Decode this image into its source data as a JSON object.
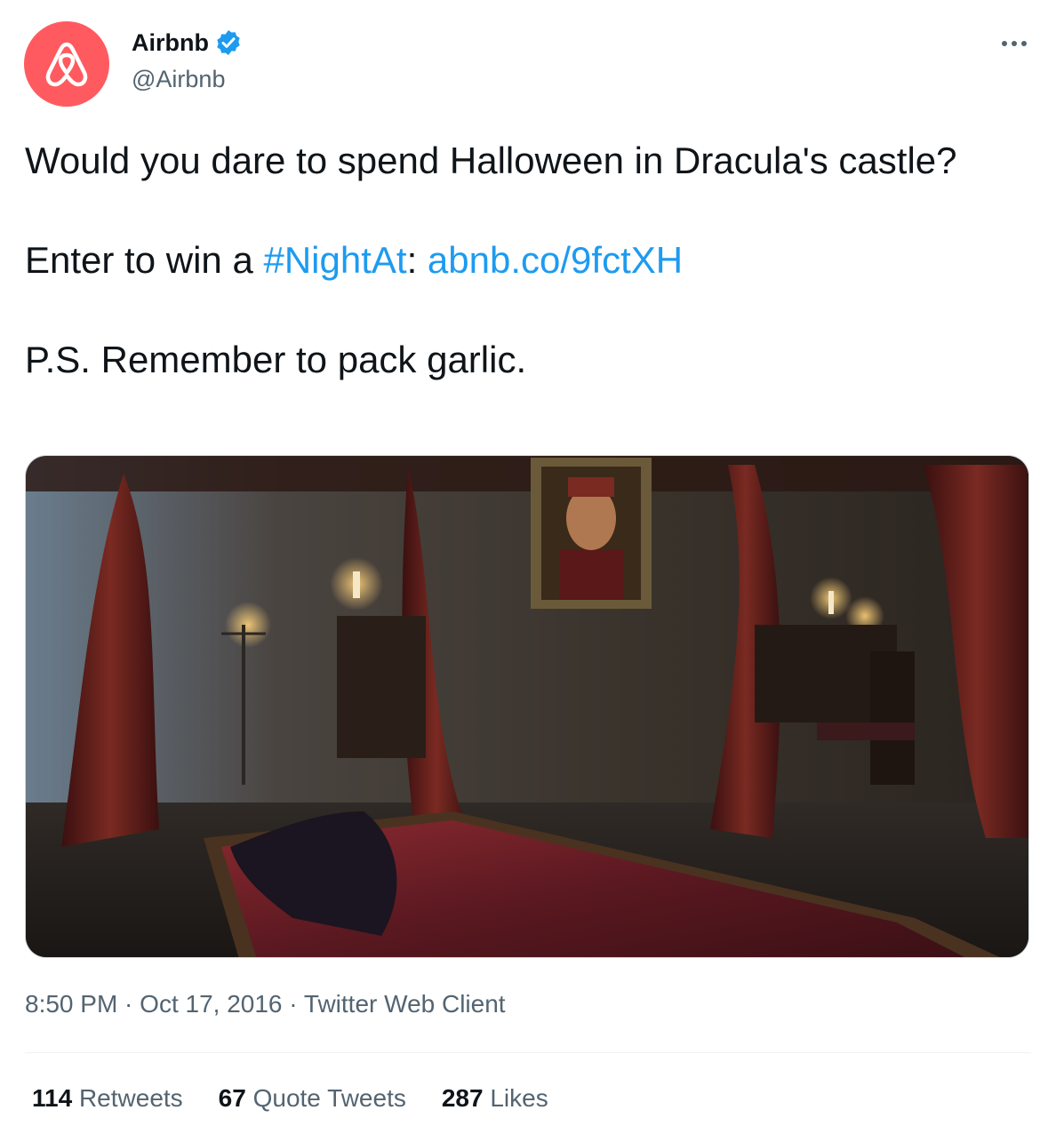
{
  "author": {
    "display_name": "Airbnb",
    "handle": "@Airbnb",
    "verified": true,
    "avatar_icon": "airbnb-logo-icon",
    "avatar_color": "#ff5a5f",
    "verified_color": "#1d9bf0"
  },
  "menu_icon": "more-horizontal-icon",
  "tweet": {
    "line1": "Would you dare to spend Halloween in Dracula's castle?",
    "line2_prefix": "Enter to win a ",
    "hashtag": "#NightAt",
    "line2_sep": ": ",
    "link": "abnb.co/9fctXH",
    "line3": "P.S. Remember to pack garlic.",
    "link_color": "#1d9bf0"
  },
  "media": {
    "description_icon": "dracula-bedroom-photo"
  },
  "meta": {
    "time": "8:50 PM",
    "sep": " · ",
    "date": "Oct 17, 2016",
    "source": "Twitter Web Client"
  },
  "stats": {
    "retweets_count": "114",
    "retweets_label": " Retweets",
    "quotes_count": "67",
    "quotes_label": " Quote Tweets",
    "likes_count": "287",
    "likes_label": " Likes"
  }
}
